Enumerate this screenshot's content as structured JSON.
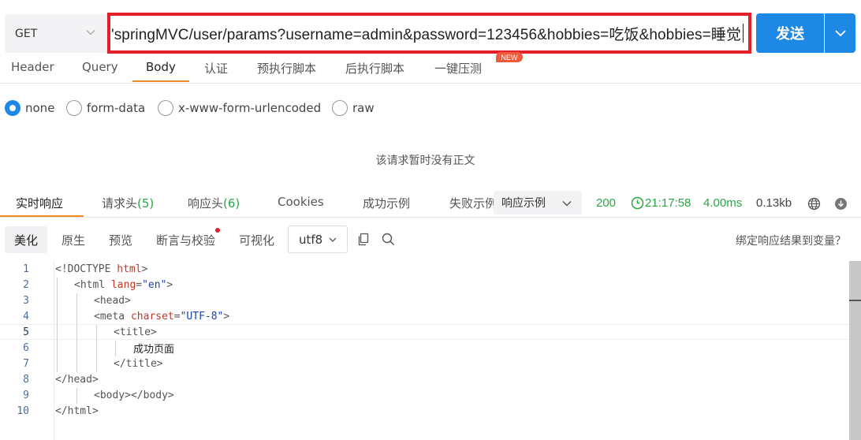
{
  "request": {
    "method": "GET",
    "url": "'springMVC/user/params?username=admin&password=123456&hobbies=吃饭&hobbies=睡觉",
    "send_label": "发送"
  },
  "request_tabs": [
    {
      "label": "Header"
    },
    {
      "label": "Query"
    },
    {
      "label": "Body"
    },
    {
      "label": "认证"
    },
    {
      "label": "预执行脚本"
    },
    {
      "label": "后执行脚本"
    },
    {
      "label": "一键压测"
    }
  ],
  "new_badge": "NEW",
  "body_types": [
    {
      "label": "none",
      "checked": true
    },
    {
      "label": "form-data",
      "checked": false
    },
    {
      "label": "x-www-form-urlencoded",
      "checked": false
    },
    {
      "label": "raw",
      "checked": false
    }
  ],
  "no_body_text": "该请求暂时没有正文",
  "response_tabs": [
    {
      "label": "实时响应",
      "count": ""
    },
    {
      "label": "请求头",
      "count": "(5)"
    },
    {
      "label": "响应头",
      "count": "(6)"
    },
    {
      "label": "Cookies",
      "count": ""
    },
    {
      "label": "成功示例",
      "count": ""
    },
    {
      "label": "失败示例",
      "count": ""
    }
  ],
  "example_select": "响应示例",
  "status": {
    "code": "200",
    "time": "21:17:58",
    "duration": "4.00ms",
    "size": "0.13kb"
  },
  "view_tabs": [
    {
      "label": "美化"
    },
    {
      "label": "原生"
    },
    {
      "label": "预览"
    },
    {
      "label": "断言与校验"
    },
    {
      "label": "可视化"
    }
  ],
  "encoding": "utf8",
  "bind_link": "绑定响应结果到变量？",
  "code_lines": [
    {
      "num": "1"
    },
    {
      "num": "2"
    },
    {
      "num": "3"
    },
    {
      "num": "4"
    },
    {
      "num": "5"
    },
    {
      "num": "6"
    },
    {
      "num": "7"
    },
    {
      "num": "8"
    },
    {
      "num": "9"
    },
    {
      "num": "10"
    }
  ],
  "code_text": {
    "doctype_kw": "html",
    "lang_attr": "lang",
    "lang_val": "\"en\"",
    "charset_attr": "charset",
    "charset_val": "\"UTF-8\"",
    "title_text": "成功页面"
  }
}
